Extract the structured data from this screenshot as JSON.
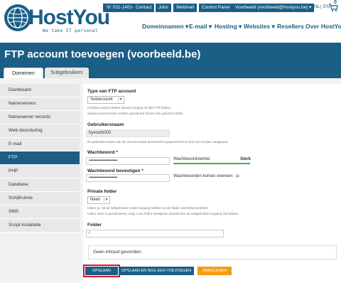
{
  "brand": {
    "name": "HostYou",
    "tagline": "We take IT personal"
  },
  "topbar": {
    "phone": "011-140140",
    "contact": "Contact",
    "jobs": "Jobs",
    "webmail": "Webmail",
    "control_panel": "Control Panel",
    "account": "Voorbeeld (voorbeeld@hostyou.be)",
    "lang_nl": "NL",
    "lang_sep": "|",
    "lang_en": "EN",
    "cart_count": "0"
  },
  "nav": {
    "domains": "Domeinnamen",
    "email": "E-mail",
    "hosting": "Hosting",
    "websites": "Websites",
    "resellers": "Resellers",
    "about": "Over HostYou"
  },
  "page": {
    "title": "FTP account toevoegen (voorbeeld.be)"
  },
  "tabs": {
    "domains": "Domeinen",
    "subusers": "Subgebruikers"
  },
  "sidebar": {
    "items": [
      {
        "label": "Dashboard"
      },
      {
        "label": "Nameservers"
      },
      {
        "label": "Nameserver records"
      },
      {
        "label": "Web doorsturing"
      },
      {
        "label": "E-mail"
      },
      {
        "label": "FTP"
      },
      {
        "label": "PHP"
      },
      {
        "label": "Database"
      },
      {
        "label": "Schijfruimte"
      },
      {
        "label": "SMS"
      },
      {
        "label": "Script installatie"
      }
    ]
  },
  "form": {
    "type_label": "Type van FTP account",
    "type_value": "Subaccount",
    "type_note1": "Hoofdaccounts hebben steeds toegang tot alle FTP folders.",
    "type_note2": "Subaccounts kunnen worden geïsoleerd binnen één gekozen folder.",
    "username_label": "Gebruikersnaam",
    "username_value": "hyvoorb002",
    "username_note": "De gebruikersnaam van de account wordt automatisch gegenereerd en kan niet worden aangepast.",
    "password_label": "Wachtwoord *",
    "password_value": "••••••••••••••••••••••••••••••••",
    "strength_label": "Wachtwoordsterkte:",
    "strength_value": "Sterk",
    "confirm_label": "Wachtwoord bevestigen *",
    "confirm_value": "••••••••••••••••••••••••••••••••",
    "match_label": "Wachtwoorden komen overeen:",
    "match_value": "ja",
    "private_label": "Private folder",
    "private_value": "Neen",
    "private_note1": "Indien ja, zal de subgebruiker enkel toegang hebben tot de folder /users/hyvoorb002/.",
    "private_note2": "Indien neen is geselecteerd, mag u een folder meegeven waarbinnen de subgebruiker toegang zal hebben.",
    "folder_label": "Folder",
    "folder_value": "/"
  },
  "message": "Geen inhoud gevonden.",
  "buttons": {
    "save": "OPSLAAN",
    "save_add": "OPSLAAN EN NOG EEN TOEVOEGEN",
    "cancel": "ANNULEREN"
  },
  "colors": {
    "brand_blue": "#1b5e86",
    "accent_orange": "#f39c12",
    "strength_green": "#3ab54a",
    "focus_red": "#d4182e"
  }
}
